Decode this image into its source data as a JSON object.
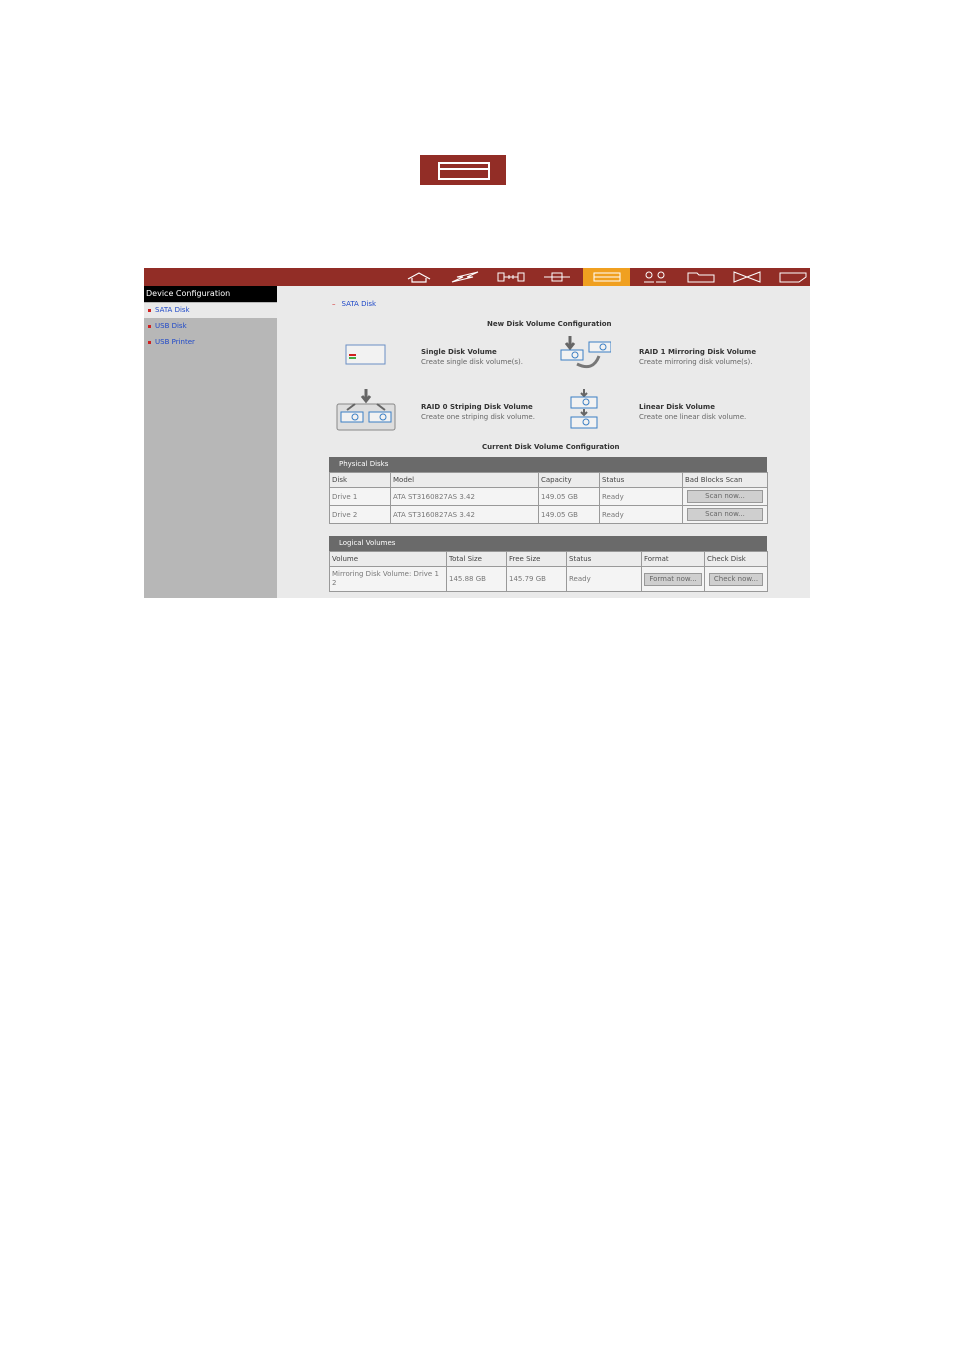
{
  "nav": {
    "icons": [
      {
        "name": "home"
      },
      {
        "name": "system"
      },
      {
        "name": "network"
      },
      {
        "name": "services"
      },
      {
        "name": "device-config",
        "active": true
      },
      {
        "name": "users"
      },
      {
        "name": "share"
      },
      {
        "name": "tools"
      },
      {
        "name": "logs"
      }
    ]
  },
  "sidebar": {
    "title": "Device Configuration",
    "items": [
      {
        "label": "SATA Disk",
        "selected": true
      },
      {
        "label": "USB Disk"
      },
      {
        "label": "USB Printer"
      }
    ]
  },
  "content": {
    "breadcrumb": "SATA Disk",
    "new_config_title": "New Disk Volume Configuration",
    "options": [
      {
        "title": "Single Disk Volume",
        "desc": "Create single disk volume(s)."
      },
      {
        "title": "RAID 1 Mirroring Disk Volume",
        "desc": "Create mirroring disk volume(s)."
      },
      {
        "title": "RAID 0 Striping Disk Volume",
        "desc": "Create one striping disk volume."
      },
      {
        "title": "Linear Disk Volume",
        "desc": "Create one linear disk volume."
      }
    ],
    "current_config_title": "Current Disk Volume Configuration",
    "physical": {
      "title": "Physical Disks",
      "headers": [
        "Disk",
        "Model",
        "Capacity",
        "Status",
        "Bad Blocks Scan"
      ],
      "rows": [
        {
          "disk": "Drive 1",
          "model": "ATA ST3160827AS 3.42",
          "capacity": "149.05 GB",
          "status": "Ready",
          "button": "Scan now..."
        },
        {
          "disk": "Drive 2",
          "model": "ATA ST3160827AS 3.42",
          "capacity": "149.05 GB",
          "status": "Ready",
          "button": "Scan now..."
        }
      ]
    },
    "logical": {
      "title": "Logical Volumes",
      "headers": [
        "Volume",
        "Total Size",
        "Free Size",
        "Status",
        "Format",
        "Check Disk"
      ],
      "rows": [
        {
          "volume": "Mirroring Disk Volume: Drive 1 2",
          "total": "145.88 GB",
          "free": "145.79 GB",
          "status": "Ready",
          "format_btn": "Format now...",
          "check_btn": "Check now..."
        }
      ]
    }
  },
  "colors": {
    "accent": "#922d26",
    "active": "#f0a020",
    "link": "#1f49c8"
  }
}
